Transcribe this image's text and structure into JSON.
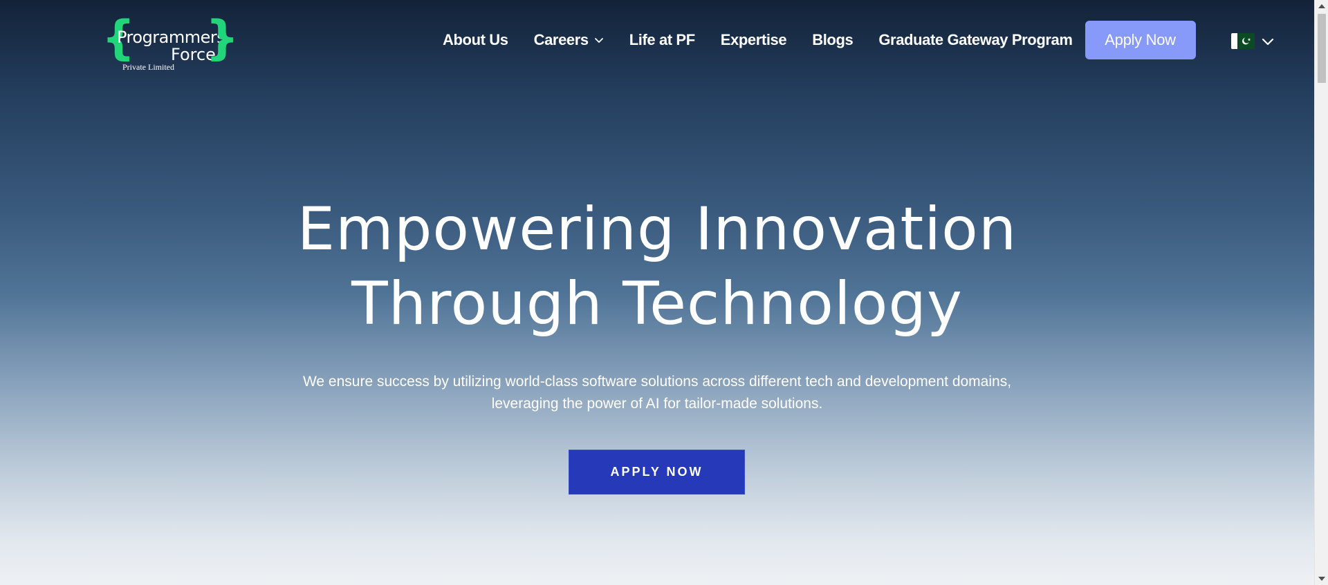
{
  "logo": {
    "line1": "Programmers",
    "line2": "Force",
    "line3": "Private Limited",
    "brace_left": "{",
    "brace_right": "}",
    "accent_color": "#22d47a"
  },
  "nav": {
    "items": [
      {
        "label": "About Us"
      },
      {
        "label": "Careers",
        "has_dropdown": true,
        "icon": "chevron-down-icon"
      },
      {
        "label": "Life at PF"
      },
      {
        "label": "Expertise"
      },
      {
        "label": "Blogs"
      },
      {
        "label": "Graduate Gateway Program"
      }
    ],
    "apply_label": "Apply Now",
    "apply_color": "#8799f9"
  },
  "language": {
    "flag": "pakistan-flag-icon",
    "icon": "chevron-down-icon"
  },
  "hero": {
    "title_line1": "Empowering Innovation",
    "title_line2": "Through Technology",
    "subtitle_line1": "We ensure success by utilizing world-class software solutions across different tech and development domains,",
    "subtitle_line2": "leveraging the power of AI for tailor-made solutions.",
    "cta_label": "APPLY NOW",
    "cta_color": "#2639b8"
  },
  "colors": {
    "background_top": "#132239",
    "background_bottom": "#eef1f4"
  }
}
